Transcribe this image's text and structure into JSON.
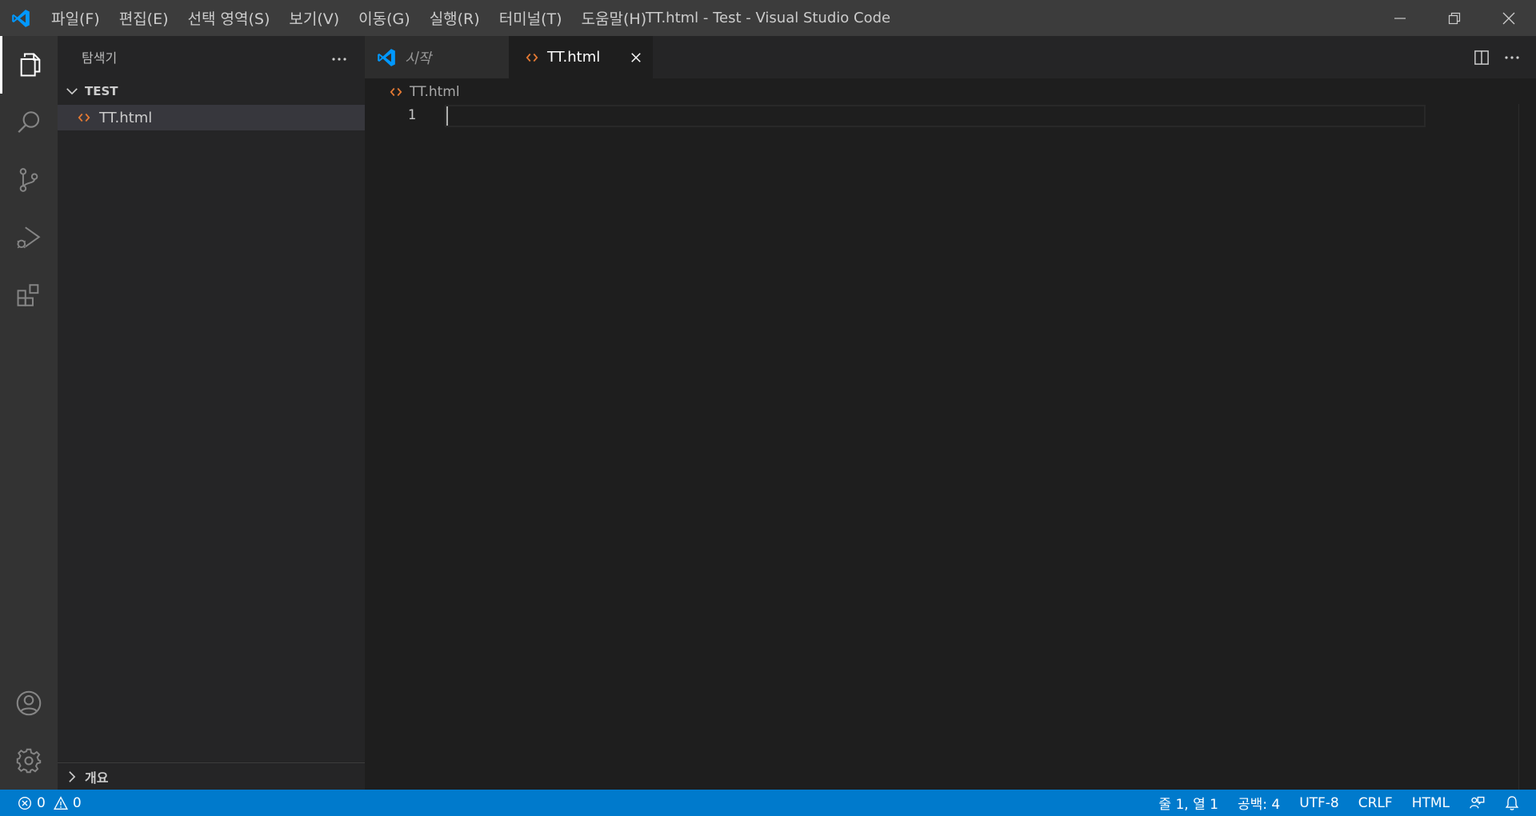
{
  "window": {
    "title": "TT.html - Test - Visual Studio Code"
  },
  "menu": [
    {
      "label": "파일(F)"
    },
    {
      "label": "편집(E)"
    },
    {
      "label": "선택 영역(S)"
    },
    {
      "label": "보기(V)"
    },
    {
      "label": "이동(G)"
    },
    {
      "label": "실행(R)"
    },
    {
      "label": "터미널(T)"
    },
    {
      "label": "도움말(H)"
    }
  ],
  "activity_bar": {
    "items": [
      "explorer-icon",
      "search-icon",
      "source-control-icon",
      "run-debug-icon",
      "extensions-icon"
    ],
    "bottom": [
      "account-icon",
      "manage-gear-icon"
    ]
  },
  "sidebar": {
    "title": "탐색기",
    "folder": "TEST",
    "files": [
      {
        "name": "TT.html"
      }
    ],
    "outline_label": "개요"
  },
  "tabs": [
    {
      "label": "시작",
      "active": false
    },
    {
      "label": "TT.html",
      "active": true
    }
  ],
  "breadcrumb": {
    "file": "TT.html"
  },
  "editor": {
    "line_numbers": [
      "1"
    ]
  },
  "status": {
    "errors": "0",
    "warnings": "0",
    "position": "줄 1, 열 1",
    "indent": "공백: 4",
    "encoding": "UTF-8",
    "eol": "CRLF",
    "language": "HTML"
  },
  "colors": {
    "accent": "#007acc",
    "html_icon": "#e37933",
    "vscode_blue": "#0098ff"
  }
}
